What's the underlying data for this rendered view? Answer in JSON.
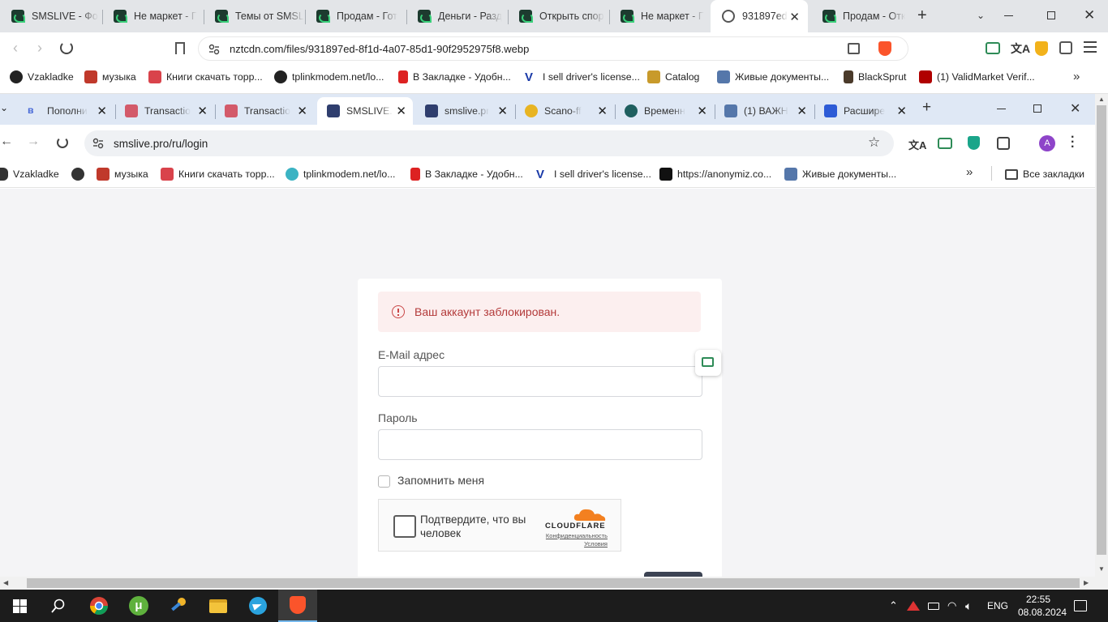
{
  "outer_browser": {
    "tabs": [
      {
        "title": "SMSLIVE - Фо"
      },
      {
        "title": "Не маркет - Г"
      },
      {
        "title": "Темы от SMSL"
      },
      {
        "title": "Продам - Гот"
      },
      {
        "title": "Деньги - Разд"
      },
      {
        "title": "Открыть спор"
      },
      {
        "title": "Не маркет - Г"
      },
      {
        "title": "931897ed"
      },
      {
        "title": "Продам - Отк"
      }
    ],
    "url": "nztcdn.com/files/931897ed-8f1d-4a07-85d1-90f2952975f8.webp",
    "bookmarks": [
      {
        "label": "Vzakladke"
      },
      {
        "label": "музыка"
      },
      {
        "label": "Книги скачать торр..."
      },
      {
        "label": "tplinkmodem.net/lo..."
      },
      {
        "label": "В Закладке - Удобн..."
      },
      {
        "label": "I sell driver's license..."
      },
      {
        "label": "Catalog"
      },
      {
        "label": "Живые документы..."
      },
      {
        "label": "BlackSprut"
      },
      {
        "label": "(1) ValidMarket Verif..."
      }
    ]
  },
  "inner_browser": {
    "tabs": [
      {
        "title": "Пополни"
      },
      {
        "title": "Transactio"
      },
      {
        "title": "Transactio"
      },
      {
        "title": "SMSLIVE.p"
      },
      {
        "title": "smslive.pr"
      },
      {
        "title": "Scano-ff"
      },
      {
        "title": "Временн"
      },
      {
        "title": "(1) ВАЖН"
      },
      {
        "title": "Расшире"
      }
    ],
    "url": "smslive.pro/ru/login",
    "profile_initial": "A",
    "bookmarks": [
      {
        "label": "Vzakladke"
      },
      {
        "label": "музыка"
      },
      {
        "label": "Книги скачать торр..."
      },
      {
        "label": "tplinkmodem.net/lo..."
      },
      {
        "label": "В Закладке - Удобн..."
      },
      {
        "label": "I sell driver's license..."
      },
      {
        "label": "https://anonymiz.co..."
      },
      {
        "label": "Живые документы..."
      }
    ],
    "all_bookmarks_label": "Все закладки"
  },
  "login": {
    "alert": "Ваш аккаунт заблокирован.",
    "email_label": "E-Mail адрес",
    "email_value": "",
    "password_label": "Пароль",
    "password_value": "",
    "remember_label": "Запомнить меня",
    "remember_checked": false,
    "captcha": {
      "text": "Подтвердите, что вы человек",
      "brand": "CLOUDFLARE",
      "privacy": "Конфиденциальность",
      "terms": "Условия"
    }
  },
  "taskbar": {
    "language": "ENG",
    "time": "22:55",
    "date": "08.08.2024"
  },
  "colors": {
    "alert_bg": "#fcefef",
    "alert_text": "#b33a3a",
    "inner_tabstrip": "#dfe8f5",
    "outer_tabstrip": "#e3e5e8",
    "taskbar": "#1c1c1c",
    "cloudflare_orange": "#f38020"
  }
}
